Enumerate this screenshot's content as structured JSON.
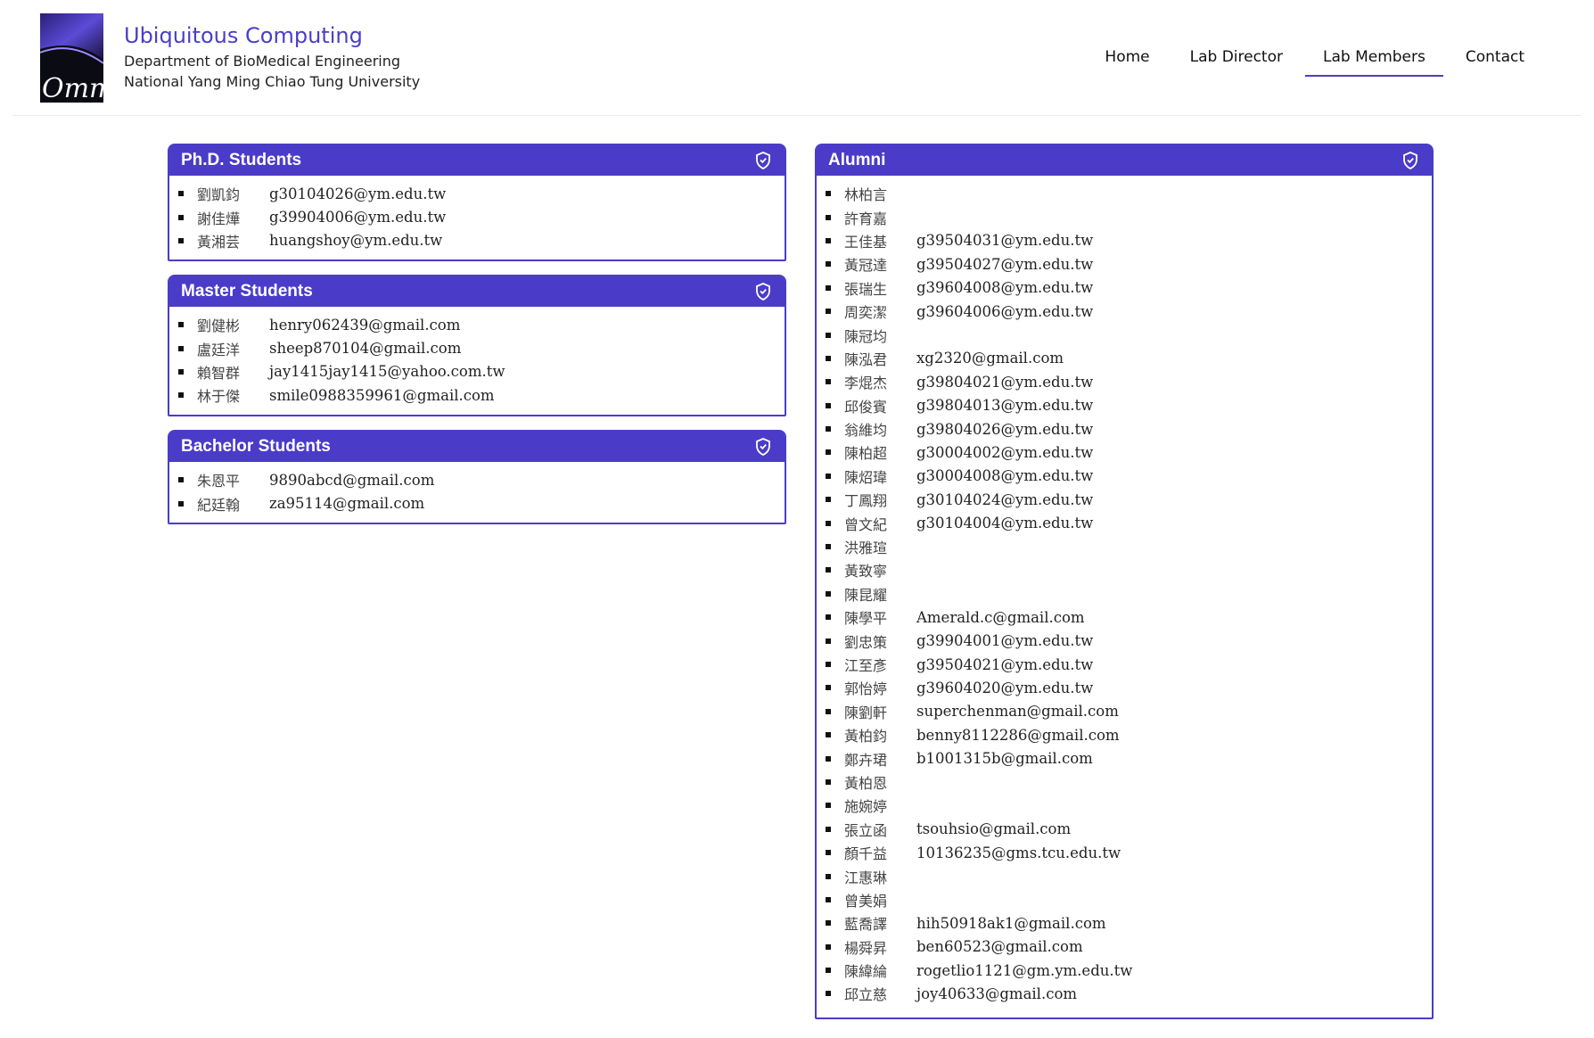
{
  "site": {
    "title": "Ubiquitous Computing",
    "department": "Department of BioMedical Engineering",
    "university": "National Yang Ming Chiao Tung University",
    "logo_text": "Omm."
  },
  "nav": {
    "items": [
      {
        "label": "Home"
      },
      {
        "label": "Lab Director"
      },
      {
        "label": "Lab Members",
        "active": true
      },
      {
        "label": "Contact"
      }
    ]
  },
  "colors": {
    "accent": "#4a3cc9"
  },
  "panels": {
    "phd": {
      "title": "Ph.D. Students",
      "icon": "shield-icon",
      "members": [
        {
          "name": "劉凱鈞",
          "email": "g30104026@ym.edu.tw"
        },
        {
          "name": "謝佳燁",
          "email": "g39904006@ym.edu.tw"
        },
        {
          "name": "黃湘芸",
          "email": "huangshoy@ym.edu.tw"
        }
      ]
    },
    "master": {
      "title": "Master Students",
      "icon": "shield-icon",
      "members": [
        {
          "name": "劉健彬",
          "email": "henry062439@gmail.com"
        },
        {
          "name": "盧廷洋",
          "email": "sheep870104@gmail.com"
        },
        {
          "name": "賴智群",
          "email": "jay1415jay1415@yahoo.com.tw"
        },
        {
          "name": "林于傑",
          "email": "smile0988359961@gmail.com"
        }
      ]
    },
    "bachelor": {
      "title": "Bachelor Students",
      "icon": "shield-icon",
      "members": [
        {
          "name": "朱恩平",
          "email": "9890abcd@gmail.com"
        },
        {
          "name": "紀廷翰",
          "email": "za95114@gmail.com"
        }
      ]
    },
    "alumni": {
      "title": "Alumni",
      "icon": "shield-icon",
      "members": [
        {
          "name": "林柏言",
          "email": ""
        },
        {
          "name": "許育嘉",
          "email": ""
        },
        {
          "name": "王佳基",
          "email": "g39504031@ym.edu.tw"
        },
        {
          "name": "黃冠達",
          "email": "g39504027@ym.edu.tw"
        },
        {
          "name": "張瑞生",
          "email": "g39604008@ym.edu.tw"
        },
        {
          "name": "周奕潔",
          "email": "g39604006@ym.edu.tw"
        },
        {
          "name": "陳冠均",
          "email": ""
        },
        {
          "name": "陳泓君",
          "email": "xg2320@gmail.com"
        },
        {
          "name": "李焜杰",
          "email": "g39804021@ym.edu.tw"
        },
        {
          "name": "邱俊賓",
          "email": "g39804013@ym.edu.tw"
        },
        {
          "name": "翁維均",
          "email": "g39804026@ym.edu.tw"
        },
        {
          "name": "陳柏超",
          "email": "g30004002@ym.edu.tw"
        },
        {
          "name": "陳炤瑋",
          "email": "g30004008@ym.edu.tw"
        },
        {
          "name": "丁鳳翔",
          "email": "g30104024@ym.edu.tw"
        },
        {
          "name": "曾文紀",
          "email": "g30104004@ym.edu.tw"
        },
        {
          "name": "洪雅瑄",
          "email": ""
        },
        {
          "name": "黃致寧",
          "email": ""
        },
        {
          "name": "陳昆耀",
          "email": ""
        },
        {
          "name": "陳學平",
          "email": "Amerald.c@gmail.com"
        },
        {
          "name": "劉忠策",
          "email": "g39904001@ym.edu.tw"
        },
        {
          "name": "江至彥",
          "email": "g39504021@ym.edu.tw"
        },
        {
          "name": "郭怡婷",
          "email": "g39604020@ym.edu.tw"
        },
        {
          "name": "陳劉軒",
          "email": "superchenman@gmail.com"
        },
        {
          "name": "黃柏鈞",
          "email": "benny8112286@gmail.com"
        },
        {
          "name": "鄭卉珺",
          "email": "b1001315b@gmail.com"
        },
        {
          "name": "黃柏恩",
          "email": ""
        },
        {
          "name": "施婉婷",
          "email": ""
        },
        {
          "name": "張立函",
          "email": "tsouhsio@gmail.com"
        },
        {
          "name": "顏千益",
          "email": "10136235@gms.tcu.edu.tw"
        },
        {
          "name": "江惠琳",
          "email": ""
        },
        {
          "name": "曾美娟",
          "email": ""
        },
        {
          "name": "藍喬譯",
          "email": "hih50918ak1@gmail.com"
        },
        {
          "name": "楊舜昇",
          "email": "ben60523@gmail.com"
        },
        {
          "name": "陳緯綸",
          "email": "rogetlio1121@gm.ym.edu.tw"
        },
        {
          "name": "邱立慈",
          "email": "joy40633@gmail.com"
        }
      ]
    }
  }
}
